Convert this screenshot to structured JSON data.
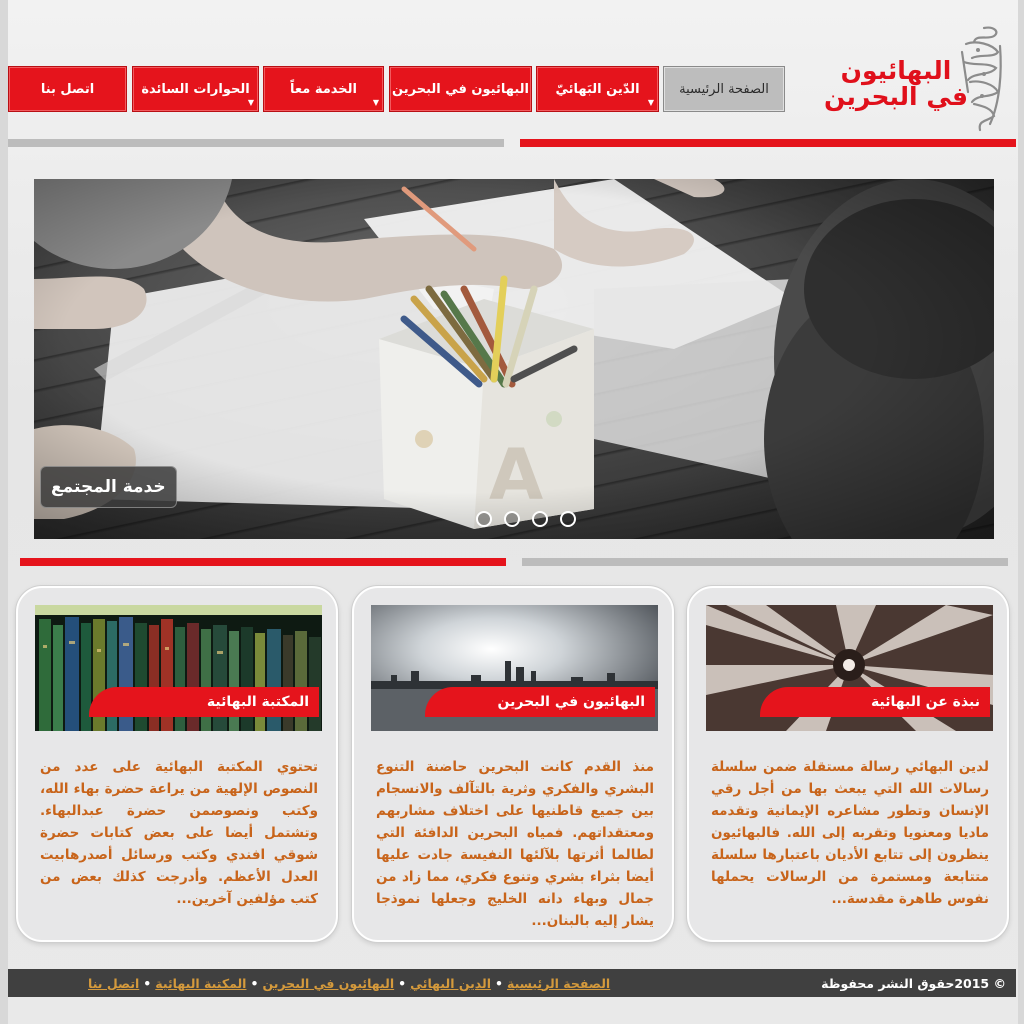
{
  "logo": {
    "line1": "البهائيون",
    "line2": "في البحرين"
  },
  "nav": {
    "items": [
      {
        "label": "الصفحة الرئيسية",
        "active": true,
        "dropdown": false
      },
      {
        "label": "الدّين البَهائيّ",
        "active": false,
        "dropdown": true
      },
      {
        "label": "البهائيون في البحرين",
        "active": false,
        "dropdown": false
      },
      {
        "label": "الخدمة معاً",
        "active": false,
        "dropdown": true
      },
      {
        "label": "الحوارات السائدة",
        "active": false,
        "dropdown": true
      },
      {
        "label": "اتصل بنا",
        "active": false,
        "dropdown": false
      }
    ]
  },
  "slider": {
    "caption": "خدمة المجتمع",
    "slide_count": 4
  },
  "cards": [
    {
      "title": "نبذة عن البهائية",
      "text": "لدين البهائي رسالة مستقلة ضمن سلسلة رسالات الله التي يبعث بها من أجل رقي الإنسان وتطور مشاعره الإيمانية وتقدمه ماديا ومعنويا وتقربه إلى الله. فالبهائيون ينظرون إلى  تتابع الأديان باعتبارها سلسلة متتابعة ومستمرة من الرسالات يحملها نفوس طاهرة مقدسة..."
    },
    {
      "title": "البهائيون في البحرين",
      "text": "منذ القدم كانت البحرين حاضنة التنوع البشري والفكري وثرية بالتآلف والانسجام بين جميع قاطنيها على اختلاف مشاربهم ومعتقداتهم.  فمياه البحرين الدافئة التي لطالما أثرتها  بلآلئها النفيسة جادت عليها أيضا بثراء بشري وتنوع فكري، مما زاد من جمال وبهاء دانه  الخليج وجعلها نموذجا يشار إليه بالبنان..."
    },
    {
      "title": "المكتبة البهائية",
      "text": "تحتوي المكتبة البهائية على عدد من النصوص الإلهية من يراعة حضرة بهاء الله، وكتب ونصوصمن حضرة عبدالبهاء. وتشتمل أيضا على بعض كتابات حضرة شوقي افندي وكتب ورسائل أصدرهابيت العدل الأعظم. وأدرجت كذلك بعض من كتب مؤلفين آخرين..."
    }
  ],
  "footer": {
    "copyright": "© 2015حقوق النشر محفوظة",
    "links": [
      "الصفحة الرئيسية",
      "الدين البهائي",
      "البهائيون في البحرين",
      "المكتبة البهائية",
      "اتصل  بنا"
    ],
    "separator": "•"
  },
  "colors": {
    "brand_red": "#e5141c",
    "text_orange": "#c8641a",
    "footer_bg": "#404040"
  },
  "icons": [
    "bahai-calligraphy-emblem",
    "dropdown-caret-icon"
  ]
}
